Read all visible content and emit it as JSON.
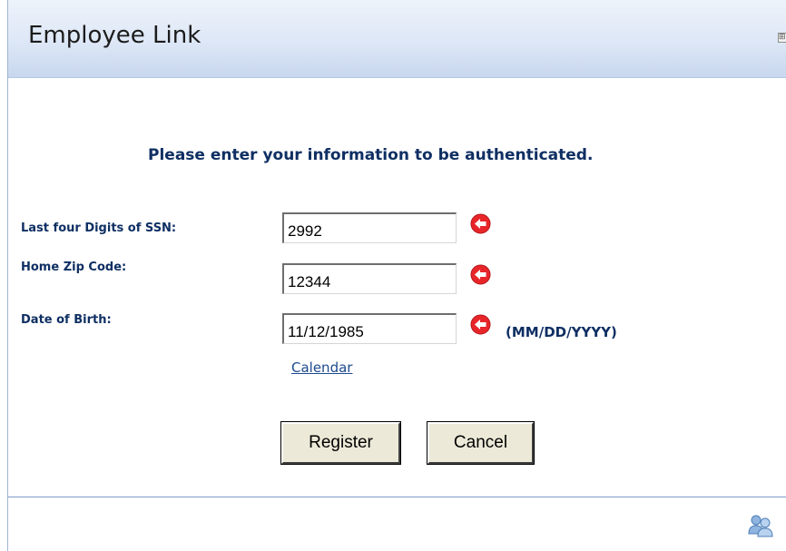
{
  "window": {
    "title": "Employee Link",
    "header_control_icon": "restore-icon"
  },
  "form": {
    "instructions": "Please enter your information to be authenticated.",
    "ssn": {
      "label": "Last four Digits of SSN:",
      "value": "2992",
      "required_icon": "required-arrow-icon"
    },
    "zip": {
      "label": "Home Zip Code:",
      "value": "12344",
      "required_icon": "required-arrow-icon"
    },
    "dob": {
      "label": "Date of Birth:",
      "value": "11/12/1985",
      "format_hint": "(MM/DD/YYYY)",
      "required_icon": "required-arrow-icon"
    },
    "calendar_link": "Calendar",
    "register_button": "Register",
    "cancel_button": "Cancel"
  },
  "footer": {
    "icon": "users-icon"
  },
  "colors": {
    "label_text": "#0f2f63",
    "link": "#1d4a8f",
    "required_icon": "#e8262a",
    "header_gradient_top": "#eef3fb",
    "header_gradient_bottom": "#c8d7ee",
    "divider": "#7f9bca"
  }
}
